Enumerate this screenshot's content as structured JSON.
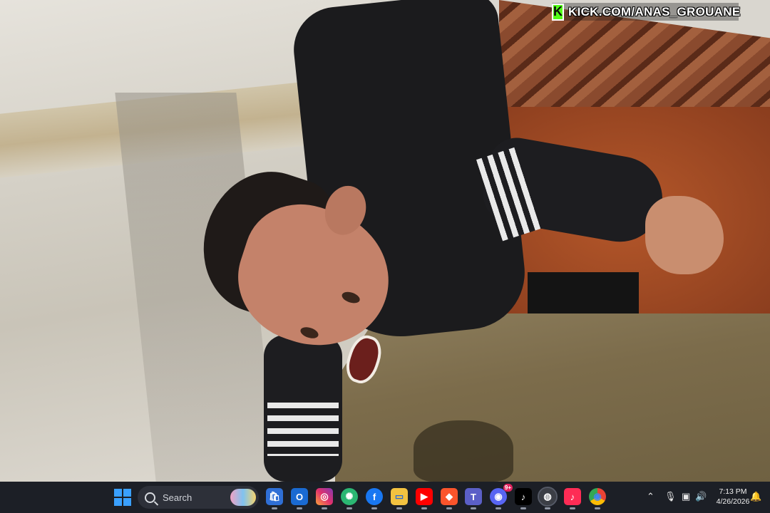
{
  "watermark": {
    "logo_letter": "K",
    "text": "KICK.COM/ANAS_GROUANE",
    "brand_color": "#53fc18"
  },
  "taskbar": {
    "start_icon": "windows-start-icon",
    "search": {
      "placeholder": "Search",
      "icon": "search-icon"
    },
    "apps": [
      {
        "name": "microsoft-store-icon",
        "glyph": "🛍"
      },
      {
        "name": "outlook-icon",
        "glyph": "O"
      },
      {
        "name": "instagram-icon",
        "glyph": "◎"
      },
      {
        "name": "chatgpt-icon",
        "glyph": "✺"
      },
      {
        "name": "facebook-icon",
        "glyph": "f"
      },
      {
        "name": "file-explorer-icon",
        "glyph": "▭"
      },
      {
        "name": "youtube-icon",
        "glyph": "▶"
      },
      {
        "name": "brave-icon",
        "glyph": "◆"
      },
      {
        "name": "teams-icon",
        "glyph": "T"
      },
      {
        "name": "discord-icon",
        "glyph": "◉",
        "badge": "9+"
      },
      {
        "name": "tiktok-icon",
        "glyph": "♪"
      },
      {
        "name": "obs-icon",
        "glyph": "◍"
      },
      {
        "name": "tiktok-live-icon",
        "glyph": "♪"
      },
      {
        "name": "chrome-icon",
        "glyph": "◉"
      }
    ],
    "tray": {
      "overflow_icon": "chevron-up-icon",
      "mic_icon": "microphone-icon",
      "network_icon": "network-icon",
      "volume_icon": "speaker-icon",
      "notification_icon": "bell-icon"
    },
    "clock": {
      "time": "7:13 PM",
      "date": "4/26/2026"
    }
  }
}
